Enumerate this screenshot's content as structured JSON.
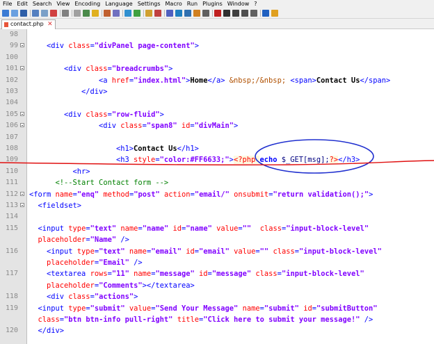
{
  "menu": [
    "File",
    "Edit",
    "Search",
    "View",
    "Encoding",
    "Language",
    "Settings",
    "Macro",
    "Run",
    "Plugins",
    "Window",
    "?"
  ],
  "tab": {
    "label": "contact.php",
    "close": "✕"
  },
  "editor": {
    "lines": [
      {
        "n": "98",
        "fold": false,
        "indent": "",
        "parts": []
      },
      {
        "n": "99",
        "fold": true,
        "indent": "    ",
        "parts": [
          [
            "tag",
            "<div "
          ],
          [
            "attr",
            "class"
          ],
          [
            "tag",
            "="
          ],
          [
            "val",
            "\"divPanel page-content\""
          ],
          [
            "tag",
            ">"
          ]
        ]
      },
      {
        "n": "100",
        "fold": false,
        "indent": "",
        "parts": []
      },
      {
        "n": "101",
        "fold": true,
        "indent": "        ",
        "parts": [
          [
            "tag",
            "<div "
          ],
          [
            "attr",
            "class"
          ],
          [
            "tag",
            "="
          ],
          [
            "val",
            "\"breadcrumbs\""
          ],
          [
            "tag",
            ">"
          ]
        ]
      },
      {
        "n": "102",
        "fold": false,
        "indent": "                ",
        "parts": [
          [
            "tag",
            "<a "
          ],
          [
            "attr",
            "href"
          ],
          [
            "tag",
            "="
          ],
          [
            "val",
            "\"index.html\""
          ],
          [
            "tag",
            ">"
          ],
          [
            "txt",
            "Home"
          ],
          [
            "tag",
            "</a>"
          ],
          [
            "txt",
            " "
          ],
          [
            "ent",
            "&nbsp;/&nbsp;"
          ],
          [
            "txt",
            " "
          ],
          [
            "tag",
            "<span>"
          ],
          [
            "txt",
            "Contact Us"
          ],
          [
            "tag",
            "</span>"
          ]
        ]
      },
      {
        "n": "103",
        "fold": false,
        "indent": "            ",
        "parts": [
          [
            "tag",
            "</div>"
          ]
        ]
      },
      {
        "n": "104",
        "fold": false,
        "indent": "",
        "parts": []
      },
      {
        "n": "105",
        "fold": true,
        "indent": "        ",
        "parts": [
          [
            "tag",
            "<div "
          ],
          [
            "attr",
            "class"
          ],
          [
            "tag",
            "="
          ],
          [
            "val",
            "\"row-fluid\""
          ],
          [
            "tag",
            ">"
          ]
        ]
      },
      {
        "n": "106",
        "fold": true,
        "indent": "                ",
        "parts": [
          [
            "tag",
            "<div "
          ],
          [
            "attr",
            "class"
          ],
          [
            "tag",
            "="
          ],
          [
            "val",
            "\"span8\""
          ],
          [
            "tag",
            " "
          ],
          [
            "attr",
            "id"
          ],
          [
            "tag",
            "="
          ],
          [
            "val",
            "\"divMain\""
          ],
          [
            "tag",
            ">"
          ]
        ]
      },
      {
        "n": "107",
        "fold": false,
        "indent": "",
        "parts": []
      },
      {
        "n": "108",
        "fold": false,
        "indent": "                    ",
        "parts": [
          [
            "tag",
            "<h1>"
          ],
          [
            "txt",
            "Contact Us"
          ],
          [
            "tag",
            "</h1>"
          ]
        ]
      },
      {
        "n": "109",
        "fold": false,
        "indent": "                    ",
        "parts": [
          [
            "tag",
            "<h3 "
          ],
          [
            "attr",
            "style"
          ],
          [
            "tag",
            "="
          ],
          [
            "val",
            "\"color:#FF6633;\""
          ],
          [
            "tag",
            ">"
          ],
          [
            "php",
            "<?php "
          ],
          [
            "kw",
            "echo"
          ],
          [
            "phpvar",
            " $_GET[msg];"
          ],
          [
            "php",
            "?>"
          ],
          [
            "tag",
            "</h3>"
          ]
        ]
      },
      {
        "n": "110",
        "fold": false,
        "indent": "          ",
        "parts": [
          [
            "tag",
            "<hr>"
          ]
        ]
      },
      {
        "n": "111",
        "fold": false,
        "indent": "      ",
        "parts": [
          [
            "cmt",
            "<!--Start Contact form -->"
          ]
        ]
      },
      {
        "n": "112",
        "fold": true,
        "indent": "",
        "parts": [
          [
            "tag",
            "<form "
          ],
          [
            "attr",
            "name"
          ],
          [
            "tag",
            "="
          ],
          [
            "val",
            "\"enq\""
          ],
          [
            "tag",
            " "
          ],
          [
            "attr",
            "method"
          ],
          [
            "tag",
            "="
          ],
          [
            "val",
            "\"post\""
          ],
          [
            "tag",
            " "
          ],
          [
            "attr",
            "action"
          ],
          [
            "tag",
            "="
          ],
          [
            "val",
            "\"email/\""
          ],
          [
            "tag",
            " "
          ],
          [
            "attr",
            "onsubmit"
          ],
          [
            "tag",
            "="
          ],
          [
            "val",
            "\"return validation();\""
          ],
          [
            "tag",
            ">"
          ]
        ]
      },
      {
        "n": "113",
        "fold": true,
        "indent": "  ",
        "parts": [
          [
            "tag",
            "<fieldset>"
          ]
        ]
      },
      {
        "n": "114",
        "fold": false,
        "indent": "",
        "parts": []
      },
      {
        "n": "115",
        "fold": false,
        "indent": "  ",
        "parts": [
          [
            "tag",
            "<input "
          ],
          [
            "attr",
            "type"
          ],
          [
            "tag",
            "="
          ],
          [
            "val",
            "\"text\""
          ],
          [
            "tag",
            " "
          ],
          [
            "attr",
            "name"
          ],
          [
            "tag",
            "="
          ],
          [
            "val",
            "\"name\""
          ],
          [
            "tag",
            " "
          ],
          [
            "attr",
            "id"
          ],
          [
            "tag",
            "="
          ],
          [
            "val",
            "\"name\""
          ],
          [
            "tag",
            " "
          ],
          [
            "attr",
            "value"
          ],
          [
            "tag",
            "="
          ],
          [
            "val",
            "\"\""
          ],
          [
            "tag",
            "  "
          ],
          [
            "attr",
            "class"
          ],
          [
            "tag",
            "="
          ],
          [
            "val",
            "\"input-block-level\""
          ]
        ]
      },
      {
        "n": "",
        "fold": false,
        "indent": "  ",
        "parts": [
          [
            "attr",
            "placeholder"
          ],
          [
            "tag",
            "="
          ],
          [
            "val",
            "\"Name\""
          ],
          [
            "tag",
            " />"
          ]
        ]
      },
      {
        "n": "116",
        "fold": false,
        "indent": "    ",
        "parts": [
          [
            "tag",
            "<input "
          ],
          [
            "attr",
            "type"
          ],
          [
            "tag",
            "="
          ],
          [
            "val",
            "\"text\""
          ],
          [
            "tag",
            " "
          ],
          [
            "attr",
            "name"
          ],
          [
            "tag",
            "="
          ],
          [
            "val",
            "\"email\""
          ],
          [
            "tag",
            " "
          ],
          [
            "attr",
            "id"
          ],
          [
            "tag",
            "="
          ],
          [
            "val",
            "\"email\""
          ],
          [
            "tag",
            " "
          ],
          [
            "attr",
            "value"
          ],
          [
            "tag",
            "="
          ],
          [
            "val",
            "\"\""
          ],
          [
            "tag",
            " "
          ],
          [
            "attr",
            "class"
          ],
          [
            "tag",
            "="
          ],
          [
            "val",
            "\"input-block-level\""
          ]
        ]
      },
      {
        "n": "",
        "fold": false,
        "indent": "    ",
        "parts": [
          [
            "attr",
            "placeholder"
          ],
          [
            "tag",
            "="
          ],
          [
            "val",
            "\"Email\""
          ],
          [
            "tag",
            " />"
          ]
        ]
      },
      {
        "n": "117",
        "fold": false,
        "indent": "    ",
        "parts": [
          [
            "tag",
            "<textarea "
          ],
          [
            "attr",
            "rows"
          ],
          [
            "tag",
            "="
          ],
          [
            "val",
            "\"11\""
          ],
          [
            "tag",
            " "
          ],
          [
            "attr",
            "name"
          ],
          [
            "tag",
            "="
          ],
          [
            "val",
            "\"message\""
          ],
          [
            "tag",
            " "
          ],
          [
            "attr",
            "id"
          ],
          [
            "tag",
            "="
          ],
          [
            "val",
            "\"message\""
          ],
          [
            "tag",
            " "
          ],
          [
            "attr",
            "class"
          ],
          [
            "tag",
            "="
          ],
          [
            "val",
            "\"input-block-level\""
          ]
        ]
      },
      {
        "n": "",
        "fold": false,
        "indent": "    ",
        "parts": [
          [
            "attr",
            "placeholder"
          ],
          [
            "tag",
            "="
          ],
          [
            "val",
            "\"Comments\""
          ],
          [
            "tag",
            "></textarea>"
          ]
        ]
      },
      {
        "n": "118",
        "fold": false,
        "indent": "    ",
        "parts": [
          [
            "tag",
            "<div "
          ],
          [
            "attr",
            "class"
          ],
          [
            "tag",
            "="
          ],
          [
            "val",
            "\"actions\""
          ],
          [
            "tag",
            ">"
          ]
        ]
      },
      {
        "n": "119",
        "fold": false,
        "indent": "  ",
        "parts": [
          [
            "tag",
            "<input "
          ],
          [
            "attr",
            "type"
          ],
          [
            "tag",
            "="
          ],
          [
            "val",
            "\"submit\""
          ],
          [
            "tag",
            " "
          ],
          [
            "attr",
            "value"
          ],
          [
            "tag",
            "="
          ],
          [
            "val",
            "\"Send Your Message\""
          ],
          [
            "tag",
            " "
          ],
          [
            "attr",
            "name"
          ],
          [
            "tag",
            "="
          ],
          [
            "val",
            "\"submit\""
          ],
          [
            "tag",
            " "
          ],
          [
            "attr",
            "id"
          ],
          [
            "tag",
            "="
          ],
          [
            "val",
            "\"submitButton\""
          ]
        ]
      },
      {
        "n": "",
        "fold": false,
        "indent": "  ",
        "parts": [
          [
            "attr",
            "class"
          ],
          [
            "tag",
            "="
          ],
          [
            "val",
            "\"btn btn-info pull-right\""
          ],
          [
            "tag",
            " "
          ],
          [
            "attr",
            "title"
          ],
          [
            "tag",
            "="
          ],
          [
            "val",
            "\"Click here to submit your message!\""
          ],
          [
            "tag",
            " />"
          ]
        ]
      },
      {
        "n": "120",
        "fold": false,
        "indent": "  ",
        "parts": [
          [
            "tag",
            "</div>"
          ]
        ]
      }
    ]
  },
  "annotations": {
    "circle_color": "#1f2fcf",
    "underline_color": "#e01010"
  }
}
